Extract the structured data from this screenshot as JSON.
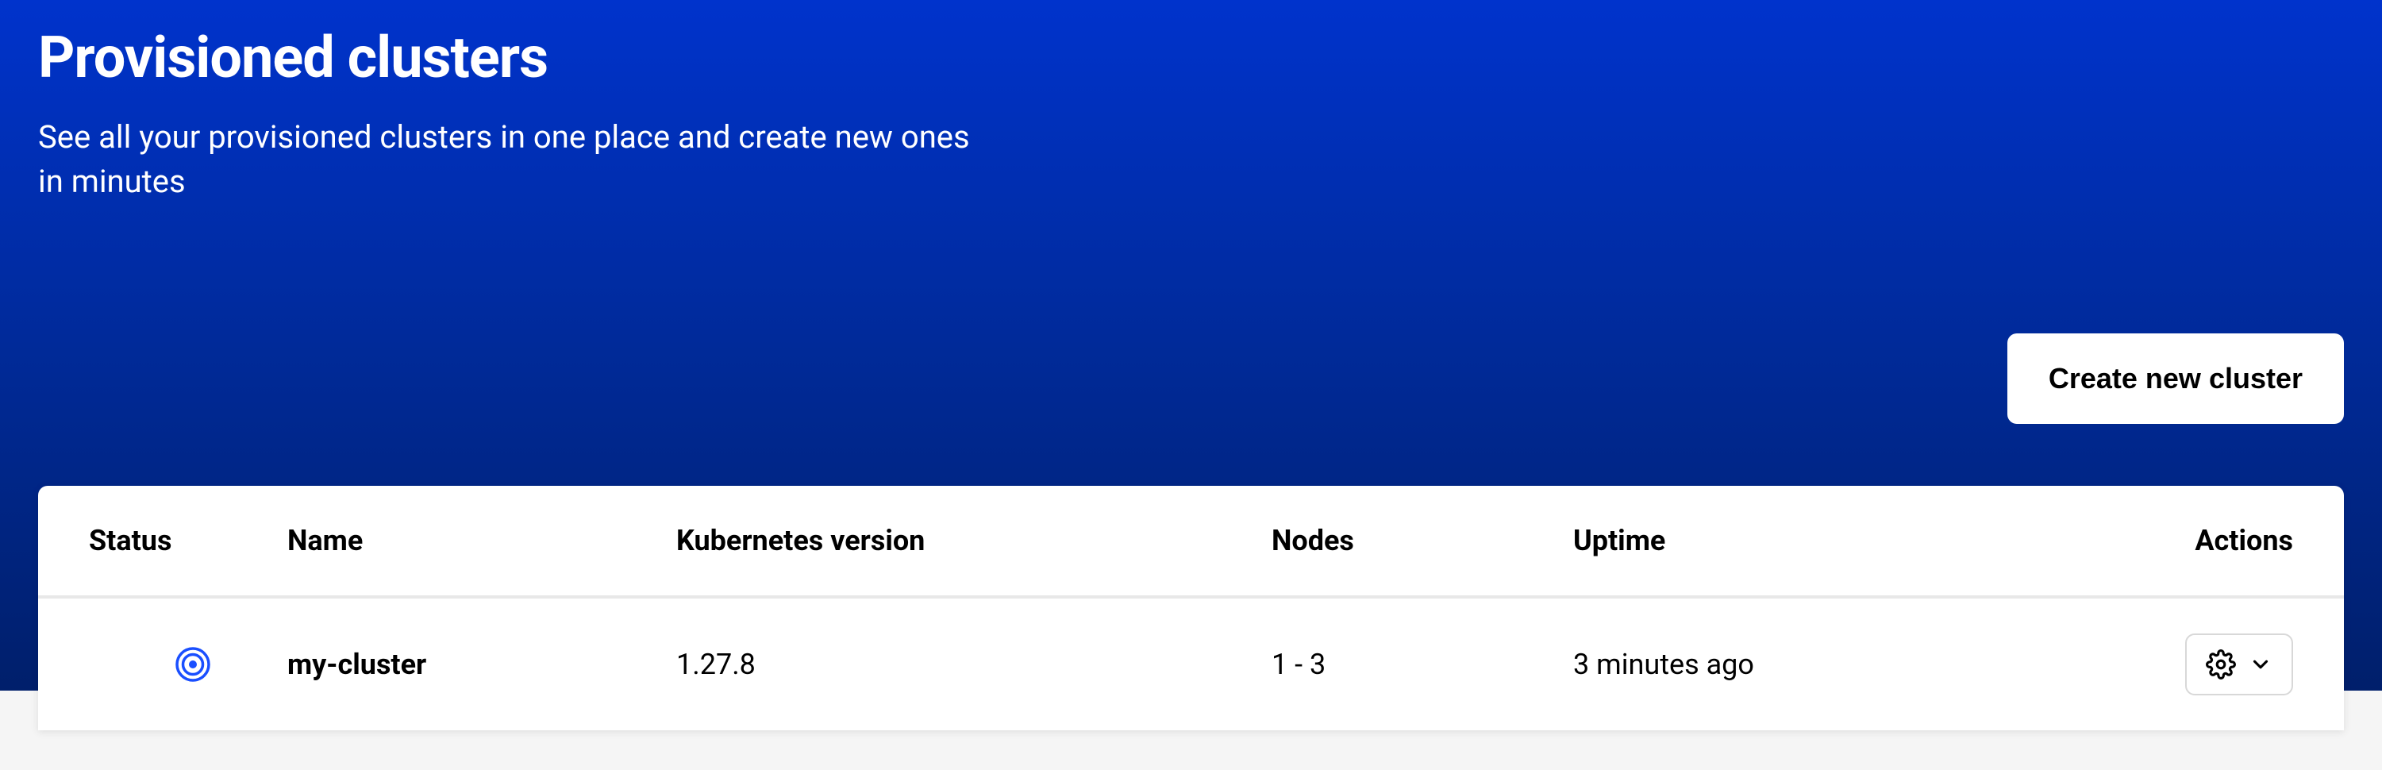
{
  "header": {
    "title": "Provisioned clusters",
    "subtitle": "See all your provisioned clusters in one place and create new ones in minutes"
  },
  "actions": {
    "create_button": "Create new cluster"
  },
  "table": {
    "columns": {
      "status": "Status",
      "name": "Name",
      "version": "Kubernetes version",
      "nodes": "Nodes",
      "uptime": "Uptime",
      "actions": "Actions"
    },
    "rows": [
      {
        "status_icon": "target-spinner-icon",
        "name": "my-cluster",
        "version": "1.27.8",
        "nodes": "1 - 3",
        "uptime": "3 minutes ago"
      }
    ]
  }
}
